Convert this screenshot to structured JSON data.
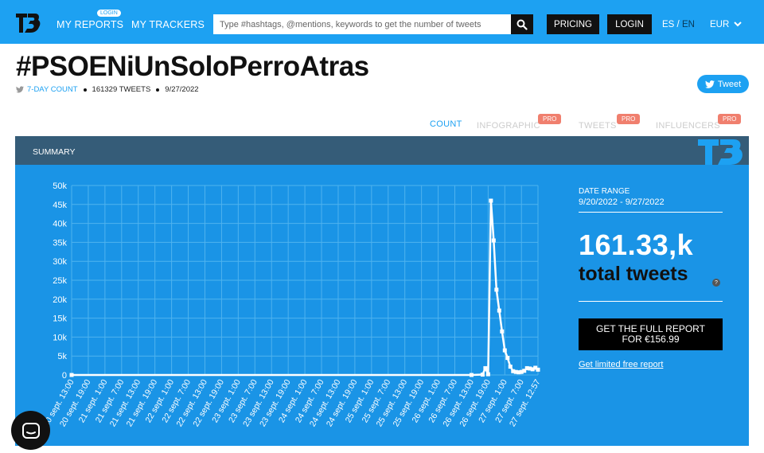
{
  "nav": {
    "reports": "MY REPORTS",
    "reports_tag": "LOGIN",
    "trackers": "MY TRACKERS",
    "search_placeholder": "Type #hashtags, @mentions, keywords to get the number of tweets",
    "pricing": "PRICING",
    "login": "LOGIN",
    "lang_es": "ES",
    "lang_sep": " / ",
    "lang_en": "EN",
    "currency": "EUR"
  },
  "header": {
    "title": "#PSOENiUnSoloPerroAtras",
    "count_label": "7-DAY COUNT",
    "tweets": "161329 TWEETS",
    "date": "9/27/2022",
    "tweet_button": "Tweet"
  },
  "tabs": [
    {
      "label": "COUNT",
      "pro": ""
    },
    {
      "label": "INFOGRAPHIC",
      "pro": "PRO"
    },
    {
      "label": "TWEETS",
      "pro": "PRO"
    },
    {
      "label": "INFLUENCERS",
      "pro": "PRO"
    }
  ],
  "summary": {
    "label": "SUMMARY",
    "date_range_label": "DATE RANGE",
    "date_range": "9/20/2022 - 9/27/2022",
    "total": "161.33,k",
    "total_label": "total tweets",
    "help": "?",
    "cta": "GET THE FULL REPORT FOR €156.99",
    "free_link": "Get limited free report"
  },
  "colors": {
    "brand": "#1da1f2",
    "panel": "#1a94e6",
    "summary_bar": "#355c78",
    "pro_badge": "#f07f6e"
  },
  "chart_data": {
    "type": "line",
    "yticks": [
      "50k",
      "45k",
      "40k",
      "35k",
      "30k",
      "25k",
      "20k",
      "15k",
      "10k",
      "5k",
      "0"
    ],
    "ylim": [
      0,
      50000
    ],
    "grid": true,
    "xticks": [
      "20 sept. 13:00",
      "20 sept. 19:00",
      "21 sept. 1:00",
      "21 sept. 7:00",
      "21 sept. 13:00",
      "21 sept. 19:00",
      "22 sept. 1:00",
      "22 sept. 7:00",
      "22 sept. 13:00",
      "22 sept. 19:00",
      "23 sept. 1:00",
      "23 sept. 7:00",
      "23 sept. 13:00",
      "23 sept. 19:00",
      "24 sept. 1:00",
      "24 sept. 7:00",
      "24 sept. 13:00",
      "24 sept. 19:00",
      "25 sept. 1:00",
      "25 sept. 7:00",
      "25 sept. 13:00",
      "25 sept. 19:00",
      "26 sept. 1:00",
      "26 sept. 7:00",
      "26 sept. 13:00",
      "26 sept. 19:00",
      "27 sept. 1:00",
      "27 sept. 7:00",
      "27 sept. 12:57"
    ],
    "x": [
      "20 sept. 13:00",
      "26 sept. 13:00",
      "26 sept. 17:00",
      "26 sept. 18:00",
      "26 sept. 19:00",
      "26 sept. 20:00",
      "26 sept. 21:00",
      "26 sept. 22:00",
      "26 sept. 23:00",
      "27 sept. 0:00",
      "27 sept. 1:00",
      "27 sept. 2:00",
      "27 sept. 3:00",
      "27 sept. 4:00",
      "27 sept. 5:00",
      "27 sept. 6:00",
      "27 sept. 7:00",
      "27 sept. 8:00",
      "27 sept. 9:00",
      "27 sept. 10:00",
      "27 sept. 11:00",
      "27 sept. 12:00",
      "27 sept. 12:57"
    ],
    "values": [
      0,
      0,
      100,
      1800,
      200,
      46000,
      35500,
      22500,
      17000,
      11500,
      6500,
      4500,
      2200,
      1000,
      800,
      700,
      800,
      1100,
      1800,
      1700,
      1500,
      1900,
      1400
    ]
  }
}
